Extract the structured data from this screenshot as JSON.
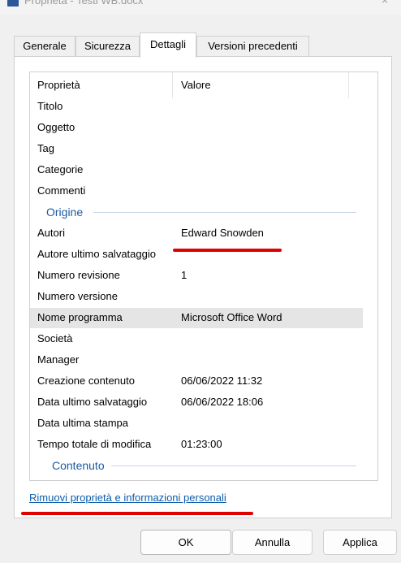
{
  "window": {
    "title": "Proprietà - Testi WB.docx",
    "close_glyph": "×",
    "icon": "word-document-icon"
  },
  "tabs": [
    {
      "label": "Generale",
      "active": false
    },
    {
      "label": "Sicurezza",
      "active": false
    },
    {
      "label": "Dettagli",
      "active": true
    },
    {
      "label": "Versioni precedenti",
      "active": false
    }
  ],
  "details": {
    "columns": {
      "property": "Proprietà",
      "value": "Valore"
    },
    "rows_top": [
      {
        "key": "Titolo",
        "value": ""
      },
      {
        "key": "Oggetto",
        "value": ""
      },
      {
        "key": "Tag",
        "value": ""
      },
      {
        "key": "Categorie",
        "value": ""
      },
      {
        "key": "Commenti",
        "value": ""
      }
    ],
    "group_origin": "Origine",
    "rows_origin": [
      {
        "key": "Autori",
        "value": "Edward Snowden"
      },
      {
        "key": "Autore ultimo salvataggio",
        "value": ""
      },
      {
        "key": "Numero revisione",
        "value": "1"
      },
      {
        "key": "Numero versione",
        "value": ""
      },
      {
        "key": "Nome programma",
        "value": "Microsoft Office Word",
        "highlighted": true
      },
      {
        "key": "Società",
        "value": ""
      },
      {
        "key": "Manager",
        "value": ""
      },
      {
        "key": "Creazione contenuto",
        "value": "06/06/2022 11:32"
      },
      {
        "key": "Data ultimo salvataggio",
        "value": "06/06/2022 18:06"
      },
      {
        "key": "Data ultima stampa",
        "value": ""
      },
      {
        "key": "Tempo totale di modifica",
        "value": "01:23:00"
      }
    ],
    "group_content": "Contenuto"
  },
  "remove_link": "Rimuovi proprietà e informazioni personali",
  "buttons": {
    "ok": "OK",
    "cancel": "Annulla",
    "apply": "Applica"
  },
  "colors": {
    "link": "#0b5cad",
    "group_header": "#1c5aa6",
    "annotation_red": "#e00000",
    "highlight_row": "#e5e5e5"
  }
}
